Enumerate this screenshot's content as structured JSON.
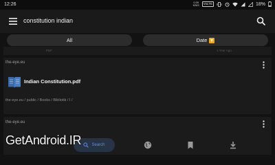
{
  "status_bar": {
    "time": "12:26",
    "network_speed_value": "0.09",
    "network_speed_unit": "KB/S",
    "volte_label": "VoLTE",
    "battery": "18%"
  },
  "search": {
    "query": "constitution indian"
  },
  "filters": {
    "all_label": "All",
    "date_label": "Date",
    "date_badge_color": "#f2a81d"
  },
  "previous_result": {
    "type": "PDF",
    "age": "1 Year Ago"
  },
  "result": {
    "source": "the-eye.eu",
    "title": "Indian Constitution.pdf",
    "path": "the-eye.eu / public / Books / Bibliotik / I /"
  },
  "next_result": {
    "source": "the-eye.eu"
  },
  "bottom_nav": {
    "search_label": "Search",
    "accent": "#6b8bd6"
  },
  "watermark": "GetAndroid.IR"
}
